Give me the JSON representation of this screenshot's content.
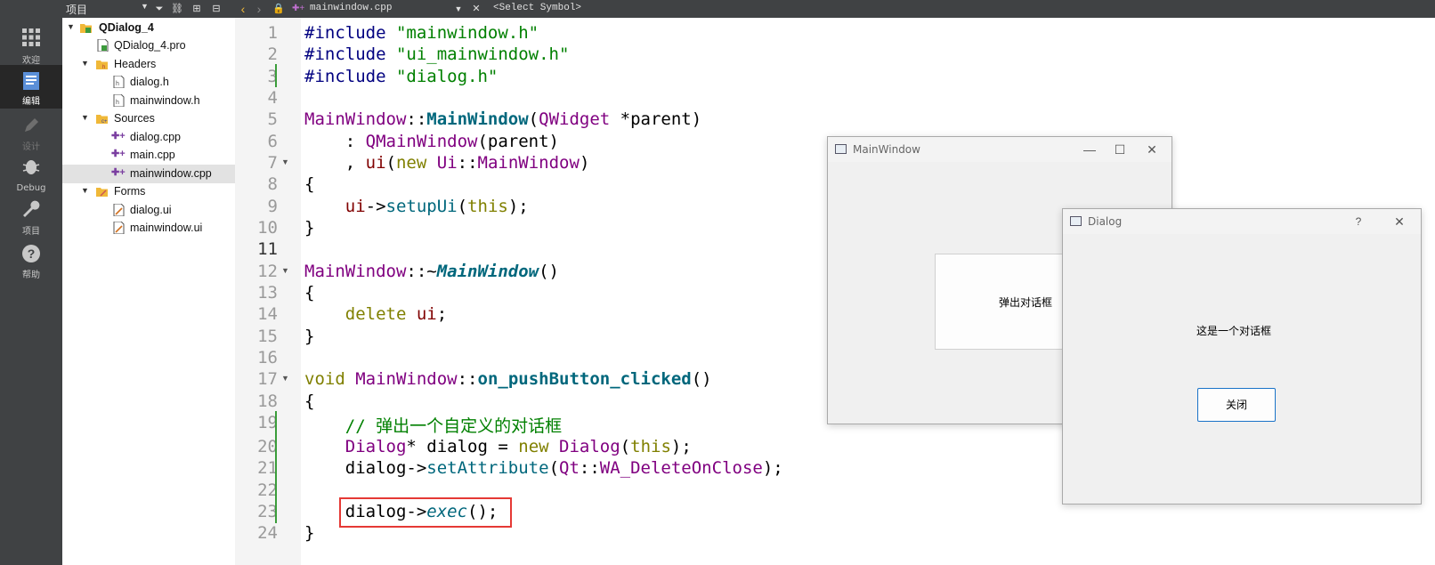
{
  "modebar": {
    "items": [
      {
        "label": "欢迎",
        "icon": "grid-icon"
      },
      {
        "label": "编辑",
        "icon": "edit-doc-icon"
      },
      {
        "label": "设计",
        "icon": "pencil-icon"
      },
      {
        "label": "Debug",
        "icon": "bug-icon"
      },
      {
        "label": "项目",
        "icon": "wrench-icon"
      },
      {
        "label": "帮助",
        "icon": "help-icon"
      }
    ]
  },
  "project_panel": {
    "title": "项目",
    "tree": [
      {
        "label": "QDialog_4",
        "depth": 0,
        "expanded": true,
        "kind": "project"
      },
      {
        "label": "QDialog_4.pro",
        "depth": 1,
        "kind": "pro"
      },
      {
        "label": "Headers",
        "depth": 1,
        "expanded": true,
        "kind": "folder"
      },
      {
        "label": "dialog.h",
        "depth": 2,
        "kind": "header"
      },
      {
        "label": "mainwindow.h",
        "depth": 2,
        "kind": "header"
      },
      {
        "label": "Sources",
        "depth": 1,
        "expanded": true,
        "kind": "folder"
      },
      {
        "label": "dialog.cpp",
        "depth": 2,
        "kind": "cpp"
      },
      {
        "label": "main.cpp",
        "depth": 2,
        "kind": "cpp"
      },
      {
        "label": "mainwindow.cpp",
        "depth": 2,
        "kind": "cpp",
        "selected": true
      },
      {
        "label": "Forms",
        "depth": 1,
        "expanded": true,
        "kind": "folder"
      },
      {
        "label": "dialog.ui",
        "depth": 2,
        "kind": "ui"
      },
      {
        "label": "mainwindow.ui",
        "depth": 2,
        "kind": "ui"
      }
    ]
  },
  "editor": {
    "file_name": "mainwindow.cpp",
    "symbol": "<Select Symbol>",
    "current_line": "11",
    "lines": [
      {
        "n": "1"
      },
      {
        "n": "2"
      },
      {
        "n": "3"
      },
      {
        "n": "4"
      },
      {
        "n": "5"
      },
      {
        "n": "6"
      },
      {
        "n": "7"
      },
      {
        "n": "8"
      },
      {
        "n": "9"
      },
      {
        "n": "10"
      },
      {
        "n": "11"
      },
      {
        "n": "12"
      },
      {
        "n": "13"
      },
      {
        "n": "14"
      },
      {
        "n": "15"
      },
      {
        "n": "16"
      },
      {
        "n": "17"
      },
      {
        "n": "18"
      },
      {
        "n": "19"
      },
      {
        "n": "20"
      },
      {
        "n": "21"
      },
      {
        "n": "22"
      },
      {
        "n": "23"
      },
      {
        "n": "24"
      }
    ],
    "code": {
      "l1": [
        "#include ",
        "\"mainwindow.h\""
      ],
      "l2": [
        "#include ",
        "\"ui_mainwindow.h\""
      ],
      "l3": [
        "#include ",
        "\"dialog.h\""
      ],
      "l5": [
        "MainWindow",
        "::",
        "MainWindow",
        "(",
        "QWidget",
        " *parent)"
      ],
      "l6": [
        "    : ",
        "QMainWindow",
        "(parent)"
      ],
      "l7": [
        "    , ",
        "ui",
        "(",
        "new",
        " ",
        "Ui",
        "::",
        "MainWindow",
        ")"
      ],
      "l8": [
        "{"
      ],
      "l9": [
        "    ",
        "ui",
        "->",
        "setupUi",
        "(",
        "this",
        ");"
      ],
      "l10": [
        "}"
      ],
      "l12": [
        "MainWindow",
        "::~",
        "MainWindow",
        "()"
      ],
      "l13": [
        "{"
      ],
      "l14": [
        "    ",
        "delete",
        " ",
        "ui",
        ";"
      ],
      "l15": [
        "}"
      ],
      "l17": [
        "void",
        " ",
        "MainWindow",
        "::",
        "on_pushButton_clicked",
        "()"
      ],
      "l18": [
        "{"
      ],
      "l19": [
        "    ",
        "// 弹出一个自定义的对话框"
      ],
      "l20": [
        "    ",
        "Dialog",
        "* dialog = ",
        "new",
        " ",
        "Dialog",
        "(",
        "this",
        ");"
      ],
      "l21": [
        "    dialog->",
        "setAttribute",
        "(",
        "Qt",
        "::",
        "WA_DeleteOnClose",
        ");"
      ],
      "l23": [
        "    dialog->",
        "exec",
        "();"
      ],
      "l24": [
        "}"
      ]
    }
  },
  "main_window": {
    "title": "MainWindow",
    "button": "弹出对话框"
  },
  "dialog_window": {
    "title": "Dialog",
    "help": "?",
    "label": "这是一个对话框",
    "close_button": "关闭"
  }
}
